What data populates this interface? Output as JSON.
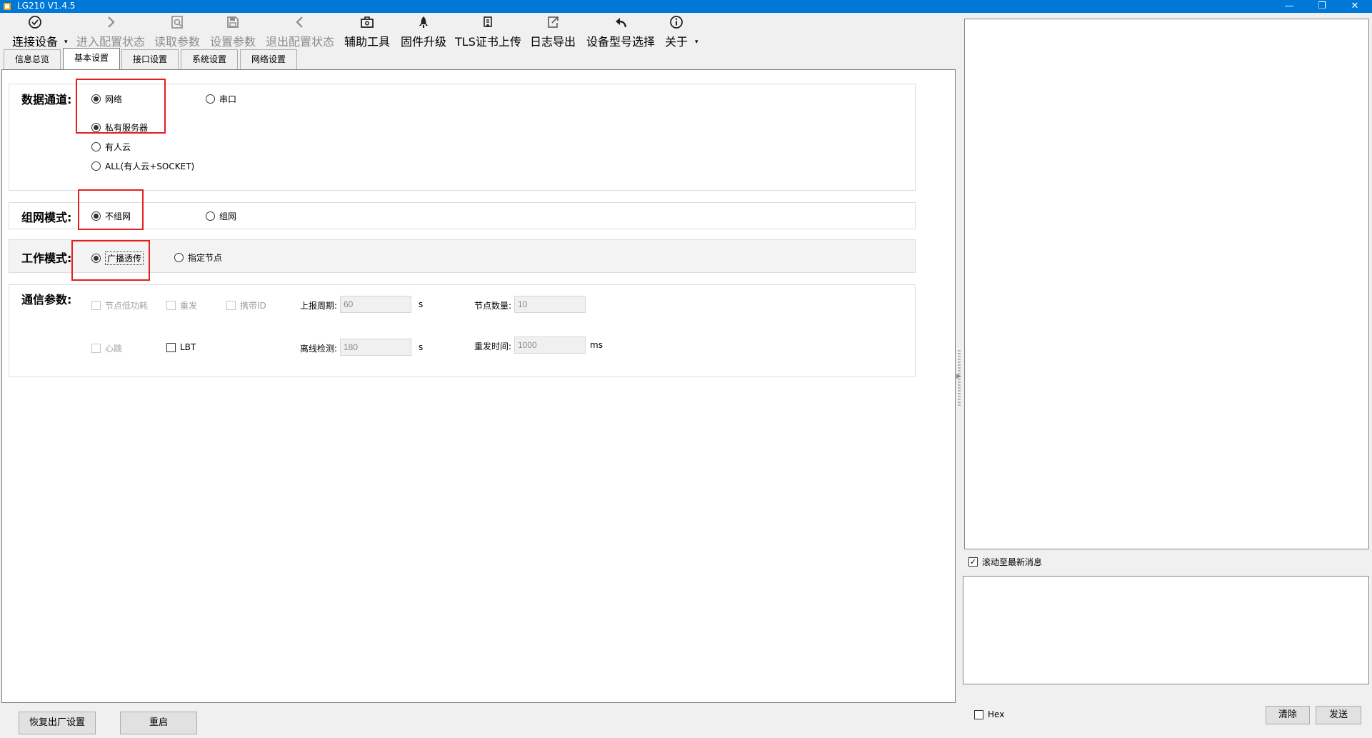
{
  "window": {
    "title": "LG210 V1.4.5",
    "controls": {
      "minimize": "—",
      "restore": "❐",
      "close": "✕"
    }
  },
  "toolbar": {
    "items": [
      {
        "label": "连接设备",
        "icon": "connect-heart-icon",
        "enabled": true,
        "dropdown": true
      },
      {
        "label": "进入配置状态",
        "icon": "chevron-right-icon",
        "enabled": false
      },
      {
        "label": "读取参数",
        "icon": "read-params-icon",
        "enabled": false
      },
      {
        "label": "设置参数",
        "icon": "save-icon",
        "enabled": false
      },
      {
        "label": "退出配置状态",
        "icon": "chevron-left-icon",
        "enabled": false
      },
      {
        "label": "辅助工具",
        "icon": "toolbox-icon",
        "enabled": true
      },
      {
        "label": "固件升级",
        "icon": "rocket-icon",
        "enabled": true
      },
      {
        "label": "TLS证书上传",
        "icon": "certificate-icon",
        "enabled": true
      },
      {
        "label": "日志导出",
        "icon": "export-icon",
        "enabled": true
      },
      {
        "label": "设备型号选择",
        "icon": "undo-arrow-icon",
        "enabled": true
      },
      {
        "label": "关于",
        "icon": "info-icon",
        "enabled": true,
        "dropdown": true
      }
    ],
    "dropdown_glyph": "▾"
  },
  "tabs": [
    {
      "label": "信息总览",
      "active": false
    },
    {
      "label": "基本设置",
      "active": true
    },
    {
      "label": "接口设置",
      "active": false
    },
    {
      "label": "系统设置",
      "active": false
    },
    {
      "label": "网络设置",
      "active": false
    }
  ],
  "data_channel": {
    "label": "数据通道:",
    "options": {
      "network": "网络",
      "serial": "串口"
    },
    "selected": "网络",
    "sub_options": {
      "private_server": "私有服务器",
      "usr_cloud": "有人云",
      "all": "ALL(有人云+SOCKET)"
    },
    "sub_selected": "私有服务器"
  },
  "network_mode": {
    "label": "组网模式:",
    "options": {
      "no_network": "不组网",
      "network": "组网"
    },
    "selected": "不组网"
  },
  "work_mode": {
    "label": "工作模式:",
    "options": {
      "broadcast": "广播透传",
      "specified_node": "指定节点"
    },
    "selected": "广播透传"
  },
  "comm_params": {
    "label": "通信参数:",
    "checkboxes": {
      "low_power": {
        "label": "节点低功耗",
        "checked": false,
        "enabled": false
      },
      "resend": {
        "label": "重发",
        "checked": false,
        "enabled": false
      },
      "carry_id": {
        "label": "携带ID",
        "checked": false,
        "enabled": false
      },
      "heartbeat": {
        "label": "心跳",
        "checked": false,
        "enabled": false
      },
      "lbt": {
        "label": "LBT",
        "checked": false,
        "enabled": true
      }
    },
    "report_period": {
      "label": "上报周期:",
      "value": "60",
      "unit": "s"
    },
    "node_count": {
      "label": "节点数量:",
      "value": "10"
    },
    "offline_detect": {
      "label": "离线检测:",
      "value": "180",
      "unit": "s"
    },
    "resend_time": {
      "label": "重发时间:",
      "value": "1000",
      "unit": "ms"
    }
  },
  "bottom_buttons": {
    "factory_reset": "恢复出厂设置",
    "restart": "重启"
  },
  "right_panel": {
    "scroll_latest": {
      "label": "滚动至最新消息",
      "checked": true
    },
    "hex": {
      "label": "Hex",
      "checked": false
    },
    "clear_button": "清除",
    "send_button": "发送"
  }
}
